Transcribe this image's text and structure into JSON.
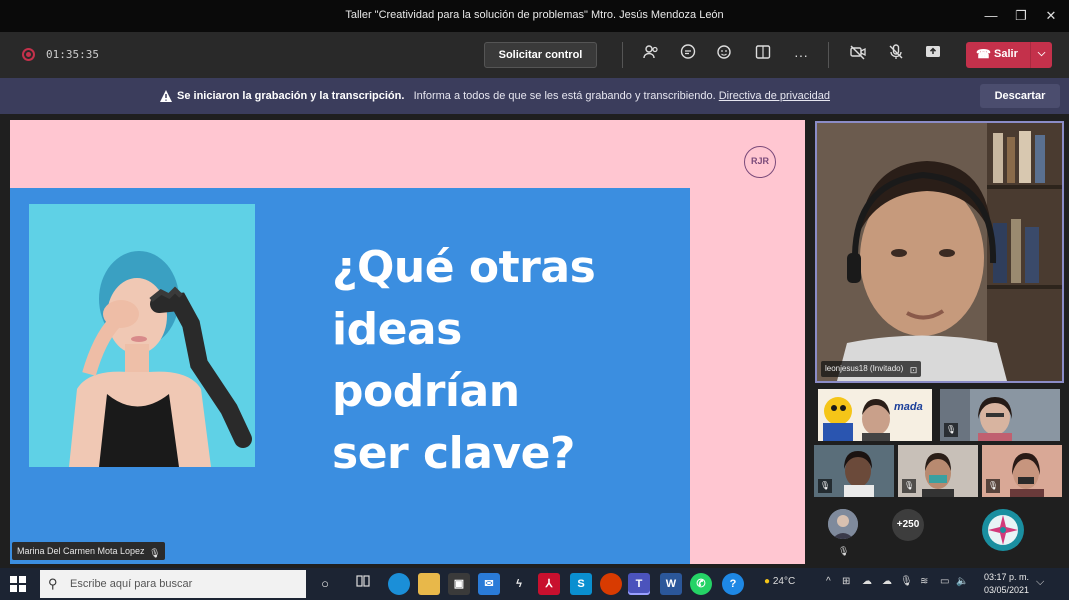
{
  "window": {
    "title": "Taller \"Creatividad para la solución de problemas\" Mtro. Jesús Mendoza León",
    "minimize": "—",
    "maximize": "❐",
    "close": "✕"
  },
  "toolbar": {
    "timer": "01:35:35",
    "request_control_label": "Solicitar control",
    "more": "···",
    "leave_label": "Salir",
    "leave_color": "#c4314b"
  },
  "banner": {
    "bold": "Se iniciaron la grabación y la transcripción.",
    "message": "Informa a todos de que se les está grabando y transcribiendo.",
    "link": "Directiva de privacidad",
    "dismiss_label": "Descartar"
  },
  "slide": {
    "logo": "RJR",
    "headline_lines": [
      "¿Qué otras",
      "ideas",
      "podrían",
      "ser clave?"
    ],
    "background": "#ffc6d1",
    "panel_color": "#3b8ee0"
  },
  "presenter": {
    "name": "Marina Del Carmen Mota Lopez"
  },
  "participants": {
    "main_video_name": "leonjesus18 (Invitado)",
    "overflow_count": "+250",
    "tile_text": "mada"
  },
  "taskbar": {
    "search_placeholder": "Escribe aquí para buscar",
    "weather": "24°C",
    "clock_time": "03:17 p. m.",
    "clock_date": "03/05/2021",
    "app_store": "S",
    "app_word": "W",
    "app_teams": "T"
  }
}
